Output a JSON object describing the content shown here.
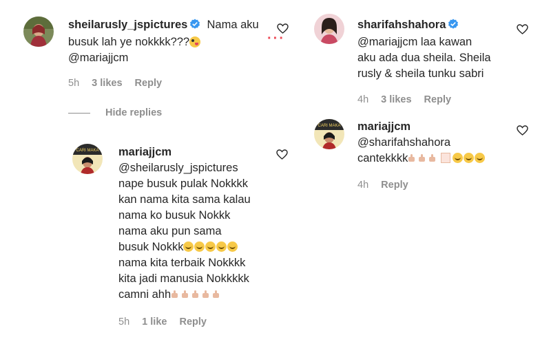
{
  "comments": {
    "c1": {
      "username": "sheilarusly_jspictures",
      "text_line1": "Nama aku",
      "text_line2": "busuk lah ye nokkkk???",
      "text_line3": "@mariajjcm",
      "time": "5h",
      "likes": "3 likes",
      "reply": "Reply",
      "verified": true
    },
    "hide_replies": "Hide replies",
    "c2": {
      "username": "mariajjcm",
      "lines": [
        "@sheilarusly_jspictures",
        "nape busuk pulak Nokkkk",
        "kan nama kita sama kalau",
        "nama ko busuk Nokkk",
        "nama aku pun sama",
        "busuk Nokkk",
        "nama kita terbaik Nokkkk",
        "kita jadi manusia Nokkkkk",
        "camni ahh"
      ],
      "time": "5h",
      "likes": "1 like",
      "reply": "Reply"
    },
    "c3": {
      "username": "sharifahshahora",
      "lines": [
        "@mariajjcm laa kawan",
        "aku ada dua sheila. Sheila",
        "rusly & sheila tunku sabri"
      ],
      "time": "4h",
      "likes": "3 likes",
      "reply": "Reply",
      "verified": true
    },
    "c4": {
      "username": "mariajjcm",
      "lines": [
        "@sharifahshahora",
        "cantekkkk"
      ],
      "time": "4h",
      "reply": "Reply"
    }
  },
  "colors": {
    "text": "#262626",
    "muted": "#8e8e8e",
    "verified": "#3897f0",
    "accent_dots": "#ed4956"
  },
  "icons": [
    "heart-icon",
    "verified-badge-icon",
    "more-dots-icon"
  ]
}
